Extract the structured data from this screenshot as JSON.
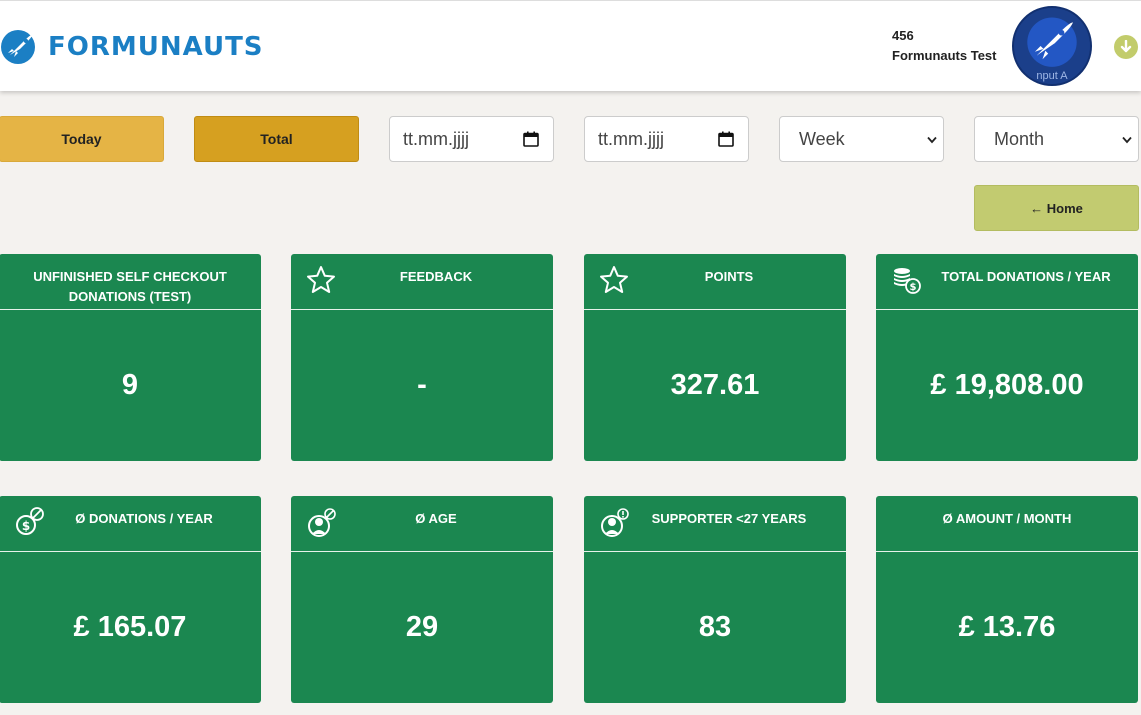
{
  "header": {
    "brand_name": "FORMUNAUTS",
    "user_id": "456",
    "user_name": "Formunauts Test",
    "avatar_text": "nput A",
    "avatar_icon": "rocket-icon",
    "dropdown_icon": "arrow-down-circle-icon",
    "brand_color": "#1b7fc4"
  },
  "filters": {
    "today_label": "Today",
    "total_label": "Total",
    "date_from_placeholder": "tt.mm.jjjj",
    "date_to_placeholder": "tt.mm.jjjj",
    "week_selected": "Week",
    "month_selected": "Month",
    "today_color": "#e5b445",
    "total_color": "#d6a020"
  },
  "home_label": "← Home",
  "home_color": "#c2cb70",
  "card_color": "#1b8750",
  "cards": [
    {
      "title": "UNFINISHED SELF CHECKOUT DONATIONS (TEST)",
      "value": "9",
      "icon": ""
    },
    {
      "title": "FEEDBACK",
      "value": "-",
      "icon": "star-icon"
    },
    {
      "title": "POINTS",
      "value": "327.61",
      "icon": "star-icon"
    },
    {
      "title": "TOTAL DONATIONS / YEAR",
      "value": "£ 19,808.00",
      "icon": "coins-icon"
    },
    {
      "title": "Ø DONATIONS / YEAR",
      "value": "£ 165.07",
      "icon": "donation-average-icon"
    },
    {
      "title": "Ø AGE",
      "value": "29",
      "icon": "user-average-icon"
    },
    {
      "title": "SUPPORTER <27 YEARS",
      "value": "83",
      "icon": "user-info-icon"
    },
    {
      "title": "Ø AMOUNT / MONTH",
      "value": "£ 13.76",
      "icon": ""
    }
  ]
}
